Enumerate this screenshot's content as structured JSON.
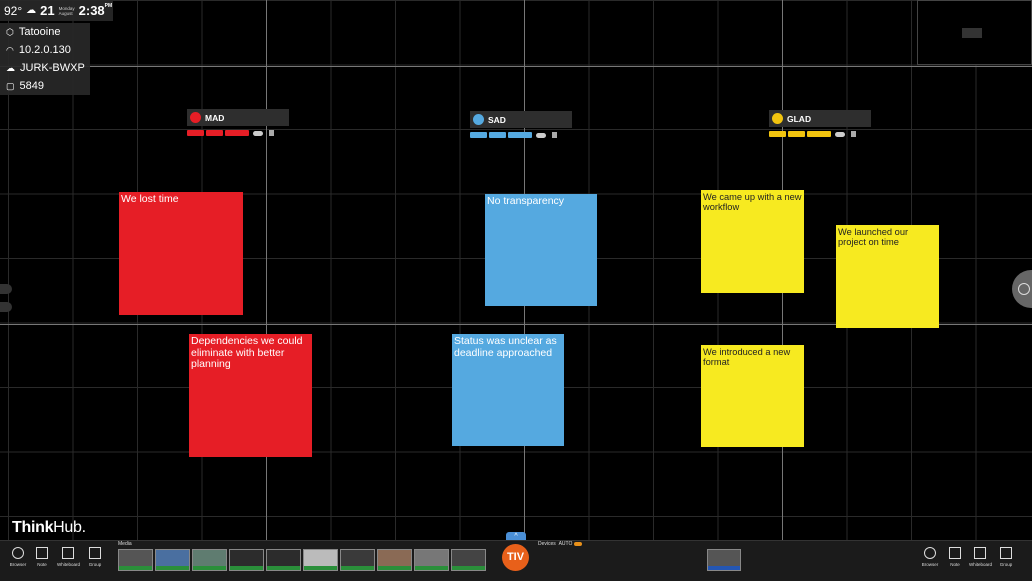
{
  "status": {
    "temperature": "92°",
    "day": "21",
    "weekday": "Monday",
    "month": "August",
    "time": "2:38",
    "ampm": "PM",
    "room": "Tatooine",
    "ip": "10.2.0.130",
    "host": "JURK-BWXP",
    "code": "5849"
  },
  "columns": [
    {
      "title": "MAD",
      "color": "#e61e26",
      "icon": "flame-icon"
    },
    {
      "title": "SAD",
      "color": "#55a9e0",
      "icon": "face-icon"
    },
    {
      "title": "GLAD",
      "color": "#f2c40f",
      "icon": "smile-icon"
    }
  ],
  "notes": {
    "mad1": "We lost time",
    "mad2": "Dependencies we could eliminate with better planning",
    "sad1": "No transparency",
    "sad2": "Status was unclear as deadline approached",
    "glad1": "We came up with a new workflow",
    "glad2": "We launched our project on time",
    "glad3": "We introduced a new format"
  },
  "logo": {
    "bold": "Think",
    "normal": "Hub."
  },
  "dock": {
    "tools": [
      "Browser",
      "Note",
      "Whiteboard",
      "Group"
    ],
    "media_label": "Media",
    "center_badge": "TIV",
    "devices_label": "Devices",
    "auto_label": "AUTO"
  }
}
